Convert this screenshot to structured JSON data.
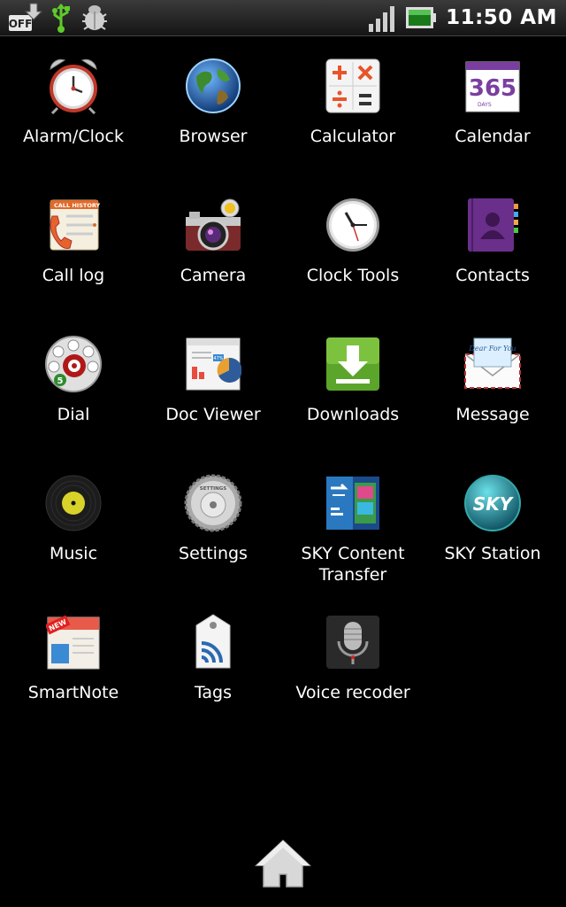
{
  "status_bar": {
    "time": "11:50 AM",
    "left_icons": [
      "off-download-icon",
      "usb-icon",
      "debug-bug-icon"
    ],
    "right_icons": [
      "signal-strength-icon",
      "battery-icon"
    ],
    "off_label": "OFF"
  },
  "apps": [
    {
      "label": "Alarm/Clock",
      "icon": "alarm-clock-icon"
    },
    {
      "label": "Browser",
      "icon": "globe-icon"
    },
    {
      "label": "Calculator",
      "icon": "calculator-icon"
    },
    {
      "label": "Calendar",
      "icon": "calendar-icon"
    },
    {
      "label": "Call log",
      "icon": "call-log-icon"
    },
    {
      "label": "Camera",
      "icon": "camera-icon"
    },
    {
      "label": "Clock Tools",
      "icon": "clock-icon"
    },
    {
      "label": "Contacts",
      "icon": "contacts-book-icon"
    },
    {
      "label": "Dial",
      "icon": "rotary-dial-icon"
    },
    {
      "label": "Doc Viewer",
      "icon": "document-chart-icon"
    },
    {
      "label": "Downloads",
      "icon": "download-arrow-icon"
    },
    {
      "label": "Message",
      "icon": "envelope-icon"
    },
    {
      "label": "Music",
      "icon": "vinyl-record-icon"
    },
    {
      "label": "Settings",
      "icon": "settings-gear-icon"
    },
    {
      "label": "SKY Content Transfer",
      "icon": "content-transfer-icon"
    },
    {
      "label": "SKY Station",
      "icon": "sky-station-icon"
    },
    {
      "label": "SmartNote",
      "icon": "smart-note-icon"
    },
    {
      "label": "Tags",
      "icon": "nfc-tag-icon"
    },
    {
      "label": "Voice recoder",
      "icon": "microphone-icon"
    }
  ],
  "icon_text": {
    "calendar_number": "365",
    "calendar_sub": "DAYS",
    "call_history": "CALL HISTORY",
    "dial_digit": "5",
    "doc_percent": "47%",
    "message_text": "Dear For You",
    "settings_text": "SETTINGS",
    "sky_text": "SKY",
    "new_badge": "NEW"
  },
  "dock": {
    "home_icon": "home-icon"
  }
}
